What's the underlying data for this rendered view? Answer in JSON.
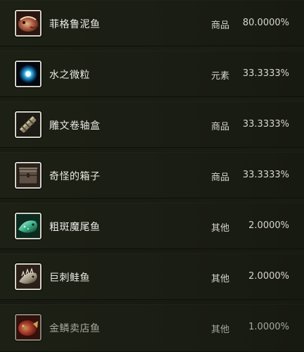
{
  "items": [
    {
      "name": "菲格鲁泥鱼",
      "type": "商品",
      "rate": "80.0000%",
      "icon": "mud-fish-icon"
    },
    {
      "name": "水之微粒",
      "type": "元素",
      "rate": "33.3333%",
      "icon": "water-mote-icon"
    },
    {
      "name": "雕文卷轴盒",
      "type": "商品",
      "rate": "33.3333%",
      "icon": "scroll-case-icon"
    },
    {
      "name": "奇怪的箱子",
      "type": "商品",
      "rate": "33.3333%",
      "icon": "strange-box-icon"
    },
    {
      "name": "粗斑魔尾鱼",
      "type": "其他",
      "rate": "2.0000%",
      "icon": "spotted-fish-icon"
    },
    {
      "name": "巨刺鲑鱼",
      "type": "其他",
      "rate": "2.0000%",
      "icon": "spiked-salmon-icon"
    },
    {
      "name": "金鳞卖店鱼",
      "type": "其他",
      "rate": "1.0000%",
      "icon": "golden-scale-fish-icon"
    }
  ]
}
